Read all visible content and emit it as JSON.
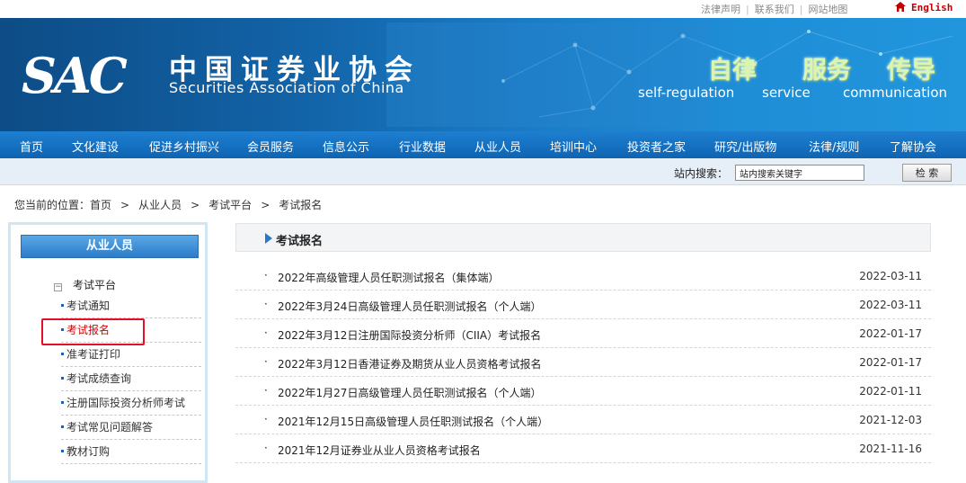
{
  "top_links": {
    "items": [
      "法律声明",
      "联系我们",
      "网站地图"
    ],
    "language": "English"
  },
  "banner": {
    "logo_abbr": "SAC",
    "org_name_cn": "中国证券业协会",
    "org_name_en": "Securities Association of China",
    "slogans": [
      {
        "cn": "自律",
        "en": "self-regulation"
      },
      {
        "cn": "服务",
        "en": "service"
      },
      {
        "cn": "传导",
        "en": "communication"
      }
    ]
  },
  "nav": {
    "items": [
      "首页",
      "文化建设",
      "促进乡村振兴",
      "会员服务",
      "信息公示",
      "行业数据",
      "从业人员",
      "培训中心",
      "投资者之家",
      "研究/出版物",
      "法律/规则",
      "了解协会"
    ]
  },
  "search": {
    "label": "站内搜索：",
    "placeholder": "站内搜索关键字",
    "button": "检 索"
  },
  "breadcrumb": {
    "prefix": "您当前的位置：",
    "items": [
      "首页",
      "从业人员",
      "考试平台",
      "考试报名"
    ],
    "separator": ">"
  },
  "sidebar": {
    "title": "从业人员",
    "group": "考试平台",
    "group_toggle": "−",
    "items": [
      {
        "label": "考试通知",
        "active": false
      },
      {
        "label": "考试报名",
        "active": true
      },
      {
        "label": "准考证打印",
        "active": false
      },
      {
        "label": "考试成绩查询",
        "active": false
      },
      {
        "label": "注册国际投资分析师考试",
        "active": false
      },
      {
        "label": "考试常见问题解答",
        "active": false
      },
      {
        "label": "教材订购",
        "active": false
      }
    ]
  },
  "content": {
    "title": "考试报名",
    "bullet": "·",
    "news": [
      {
        "title": "2022年高级管理人员任职测试报名（集体端）",
        "date": "2022-03-11"
      },
      {
        "title": "2022年3月24日高级管理人员任职测试报名（个人端）",
        "date": "2022-03-11"
      },
      {
        "title": "2022年3月12日注册国际投资分析师（CIIA）考试报名",
        "date": "2022-01-17"
      },
      {
        "title": "2022年3月12日香港证券及期货从业人员资格考试报名",
        "date": "2022-01-17"
      },
      {
        "title": "2022年1月27日高级管理人员任职测试报名（个人端）",
        "date": "2022-01-11"
      },
      {
        "title": "2021年12月15日高级管理人员任职测试报名（个人端）",
        "date": "2021-12-03"
      },
      {
        "title": "2021年12月证券业从业人员资格考试报名",
        "date": "2021-11-16"
      }
    ]
  },
  "colors": {
    "nav_bg": "#1472c2",
    "banner_bg": "#1262a6",
    "active_red": "#d80000",
    "highlight_border": "#e4102a",
    "slogan_green": "#d9f5b0"
  }
}
